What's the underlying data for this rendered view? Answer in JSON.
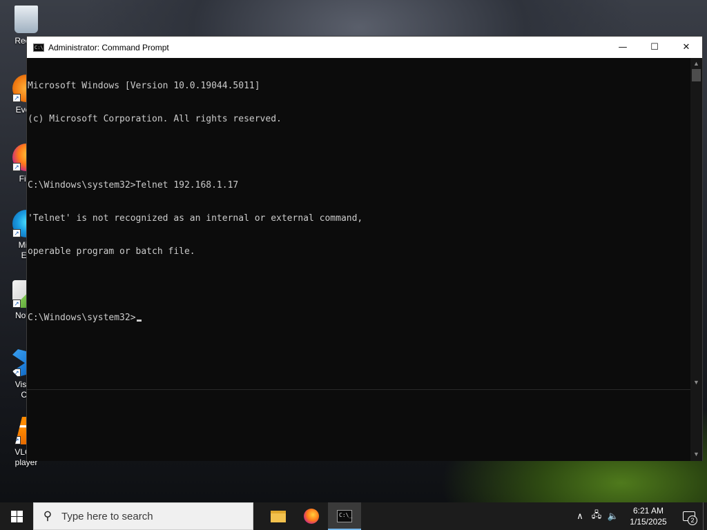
{
  "desktop": {
    "icons": [
      {
        "label": "Recyc",
        "name": "recycle-bin-icon"
      },
      {
        "label": "Every",
        "name": "everything-icon"
      },
      {
        "label": "Fire",
        "name": "firefox-desktop-icon"
      },
      {
        "label_line1": "Micr",
        "label_line2": "Ed",
        "name": "edge-icon"
      },
      {
        "label": "Notep",
        "name": "notepad-plus-icon"
      },
      {
        "label_line1": "Visual",
        "label_line2": "Co",
        "name": "vscode-icon"
      },
      {
        "label_line1": "VLC n",
        "label_line2": "player",
        "name": "vlc-icon"
      }
    ]
  },
  "window": {
    "title": "Administrator: Command Prompt",
    "app_icon_text": "C:\\",
    "minimize_glyph": "—",
    "maximize_glyph": "☐",
    "close_glyph": "✕",
    "console_lines": [
      "Microsoft Windows [Version 10.0.19044.5011]",
      "(c) Microsoft Corporation. All rights reserved.",
      "",
      "C:\\Windows\\system32>Telnet 192.168.1.17",
      "'Telnet' is not recognized as an internal or external command,",
      "operable program or batch file.",
      "",
      "C:\\Windows\\system32>"
    ]
  },
  "taskbar": {
    "search_placeholder": "Type here to search",
    "cmd_icon_text": "C:\\_",
    "clock_time": "6:21 AM",
    "clock_date": "1/15/2025",
    "notification_count": "2",
    "tray_chevron": "∧"
  }
}
